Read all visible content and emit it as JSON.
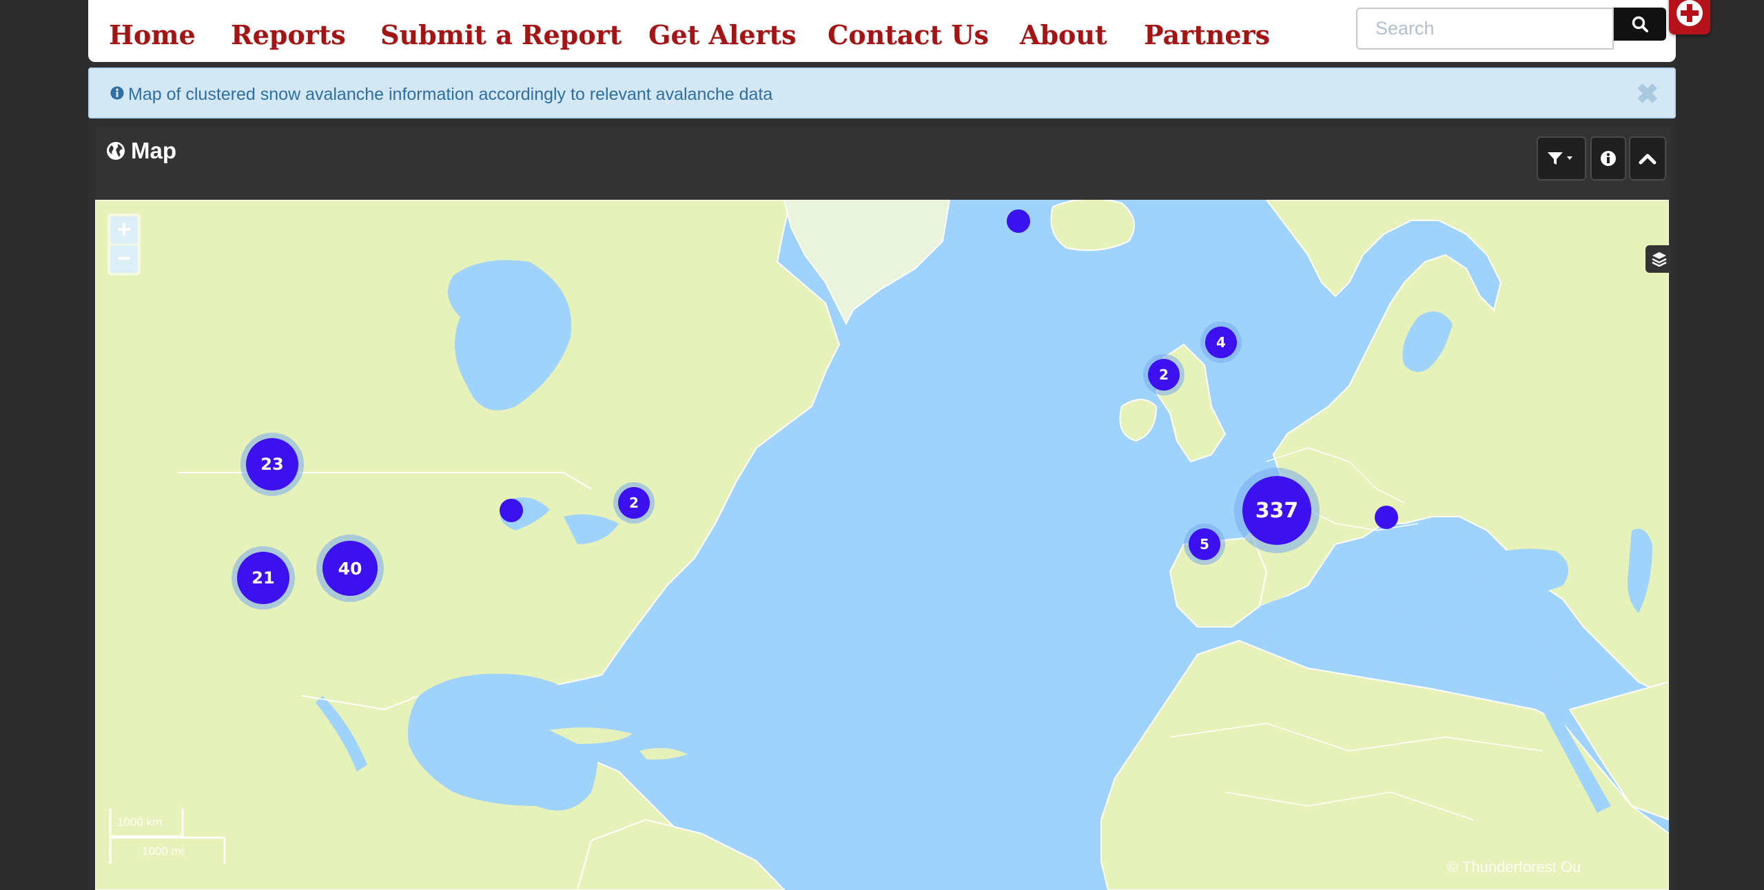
{
  "nav": {
    "items": [
      "Home",
      "Reports",
      "Submit a Report",
      "Get Alerts",
      "Contact Us",
      "About",
      "Partners"
    ],
    "search_placeholder": "Search",
    "search_icon": "search-icon",
    "help_icon": "plus-icon"
  },
  "alert": {
    "text": "Map of clustered snow avalanche information accordingly to relevant avalanche data",
    "icon": "info-icon",
    "close_label": "✖"
  },
  "panel": {
    "title": "Map",
    "title_icon": "globe-icon",
    "tools": [
      "filter-dropdown-icon",
      "info-icon",
      "chevron-up-icon"
    ]
  },
  "map": {
    "zoom_in": "+",
    "zoom_out": "−",
    "layers_icon": "layers-icon",
    "clusters": [
      {
        "label": "23"
      },
      {
        "label": "21"
      },
      {
        "label": "40"
      },
      {
        "label": "2"
      },
      {
        "label": "2"
      },
      {
        "label": "4"
      },
      {
        "label": "337"
      },
      {
        "label": "5"
      }
    ],
    "single_markers": 3,
    "scale_km": "1000 km",
    "scale_mi": "1000 mi",
    "attribution": "© Thunderforest Ou"
  },
  "colors": {
    "nav_text": "#a31515",
    "alert_bg": "#d4e7f5",
    "cluster_core": "#3d10f0",
    "water": "#a0d3fb",
    "land": "#e6f2b9"
  }
}
